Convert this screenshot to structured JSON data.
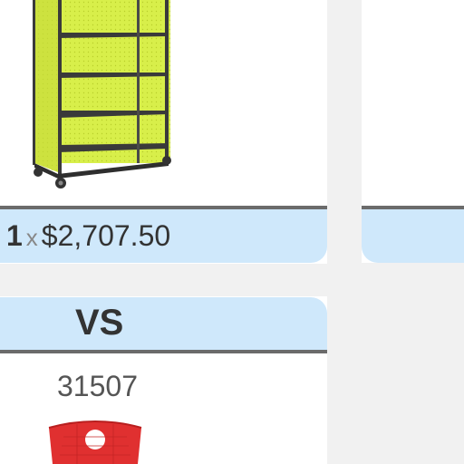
{
  "comparison_item": {
    "quantity": "1",
    "times_symbol": "x",
    "price": "$2,707.50"
  },
  "vs": {
    "label": "VS"
  },
  "compare_product": {
    "item_number": "31507"
  },
  "colors": {
    "accent_bar": "#cfe8fb",
    "divider": "#6b6b6b",
    "page_background": "#f1f1f1",
    "shelf_body": "#d8ef4a",
    "shelf_frame": "#3a3a3a",
    "chair_red": "#e03030"
  }
}
